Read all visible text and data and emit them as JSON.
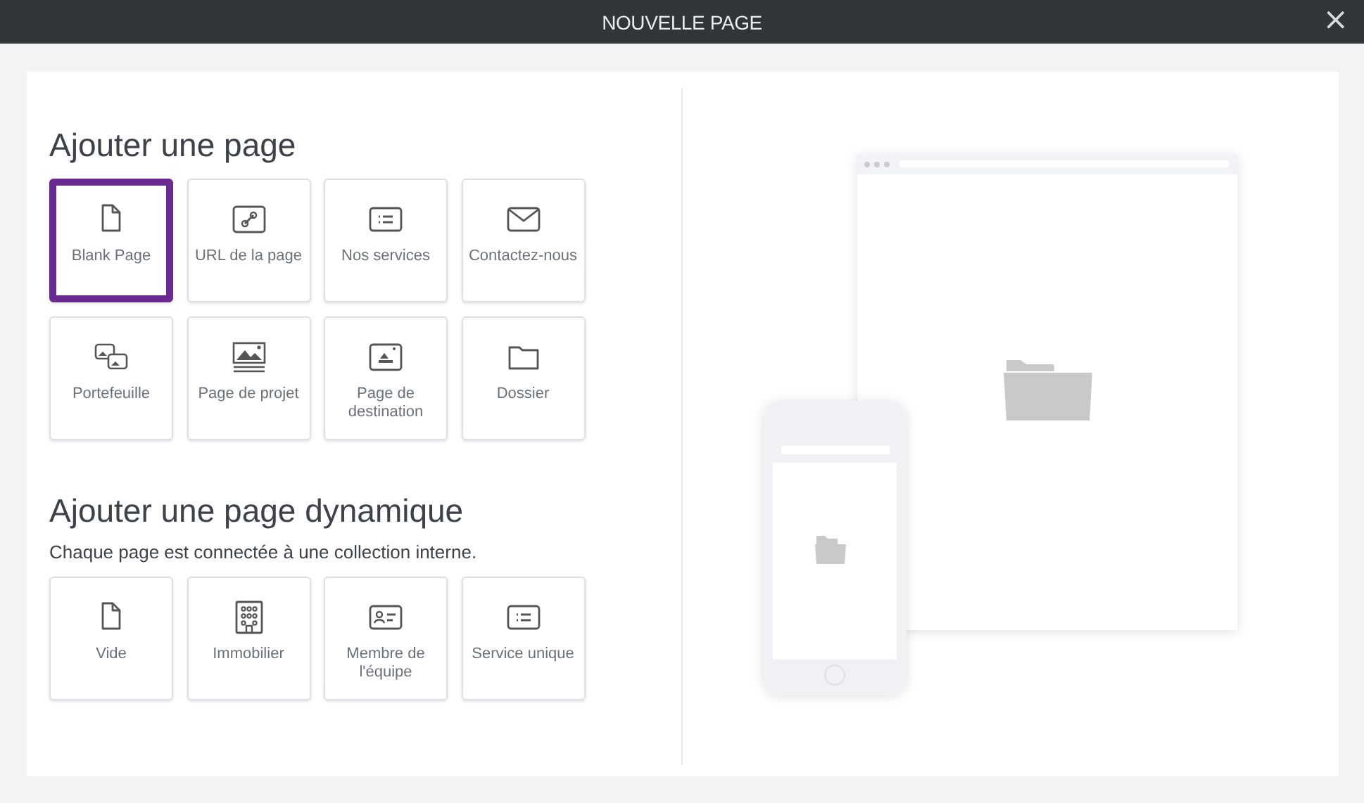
{
  "window": {
    "title": "NOUVELLE PAGE",
    "close": "×"
  },
  "sections": [
    {
      "title": "Ajouter une page",
      "tiles": [
        {
          "label": "Blank Page",
          "kind": "page",
          "selected": true
        },
        {
          "label": "URL de la page",
          "kind": "link",
          "selected": false
        },
        {
          "label": "Nos services",
          "kind": "list",
          "selected": false
        },
        {
          "label": "Contactez-nous",
          "kind": "mail",
          "selected": false
        },
        {
          "label": "Portefeuille",
          "kind": "gallery",
          "selected": false
        },
        {
          "label": "Page de projet",
          "kind": "image",
          "selected": false
        },
        {
          "label": "Page de destination",
          "kind": "landing",
          "selected": false
        },
        {
          "label": "Dossier",
          "kind": "folder",
          "selected": false
        }
      ]
    },
    {
      "title": "Ajouter une page dynamique",
      "subtitle": "Chaque page est connectée à une collection interne.",
      "tiles": [
        {
          "label": "Vide",
          "kind": "page",
          "selected": false
        },
        {
          "label": "Immobilier",
          "kind": "building",
          "selected": false
        },
        {
          "label": "Membre de l'équipe",
          "kind": "contact",
          "selected": false
        },
        {
          "label": "Service unique",
          "kind": "list",
          "selected": false
        }
      ]
    }
  ]
}
